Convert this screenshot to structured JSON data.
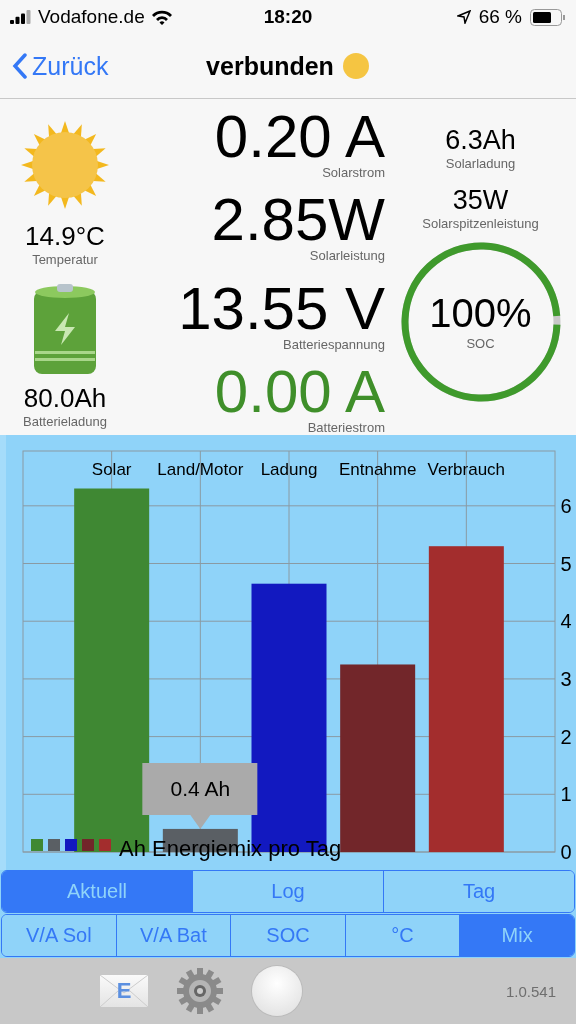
{
  "status_bar": {
    "carrier": "Vodafone.de",
    "time": "18:20",
    "battery": "66 %"
  },
  "nav": {
    "back": "Zurück",
    "title": "verbunden"
  },
  "temperature": {
    "value": "14.9°C",
    "label": "Temperatur"
  },
  "battery_charge": {
    "value": "80.0Ah",
    "label": "Batterieladung"
  },
  "readings": [
    {
      "value": "0.20 A",
      "label": "Solarstrom",
      "color": "#000000"
    },
    {
      "value": "2.85W",
      "label": "Solarleistung",
      "color": "#000000"
    },
    {
      "value": "13.55 V",
      "label": "Batteriespannung",
      "color": "#000000"
    },
    {
      "value": "0.00 A",
      "label": "Batteriestrom",
      "color": "#3f8f2a"
    }
  ],
  "side_readings": [
    {
      "value": "6.3Ah",
      "label": "Solarladung"
    },
    {
      "value": "35W",
      "label": "Solarspitzenleistung"
    }
  ],
  "soc": {
    "value": "100%",
    "label": "SOC",
    "level": 0.98
  },
  "chart_data": {
    "type": "bar",
    "title": "Ah Energiemix pro Tag",
    "grid": true,
    "series": [
      {
        "name": "Solar",
        "color": "#3f8833",
        "values": [
          6.3
        ]
      },
      {
        "name": "Land/Motor",
        "color": "#5a5f64",
        "values": [
          0.4
        ]
      },
      {
        "name": "Ladung",
        "color": "#1219c0",
        "values": [
          4.65
        ]
      },
      {
        "name": "Entnahme",
        "color": "#72262a",
        "values": [
          3.25
        ]
      },
      {
        "name": "Verbrauch",
        "color": "#a32d2d",
        "values": [
          5.3
        ]
      }
    ],
    "ylim": [
      0,
      6.95
    ],
    "yticks": [
      0,
      1,
      2,
      3,
      4,
      5,
      6
    ],
    "annotations": [
      "0.4 Ah"
    ]
  },
  "tabs": [
    {
      "label": "Aktuell",
      "selected": true
    },
    {
      "label": "Log",
      "selected": false
    },
    {
      "label": "Tag",
      "selected": false
    }
  ],
  "chart_tabs": [
    {
      "label": "V/A Sol",
      "selected": false
    },
    {
      "label": "V/A Bat",
      "selected": false
    },
    {
      "label": "SOC",
      "selected": false
    },
    {
      "label": "°C",
      "selected": false
    },
    {
      "label": "Mix",
      "selected": true
    }
  ],
  "toolbar": {
    "mail_letter": "E",
    "version": "1.0.541"
  }
}
